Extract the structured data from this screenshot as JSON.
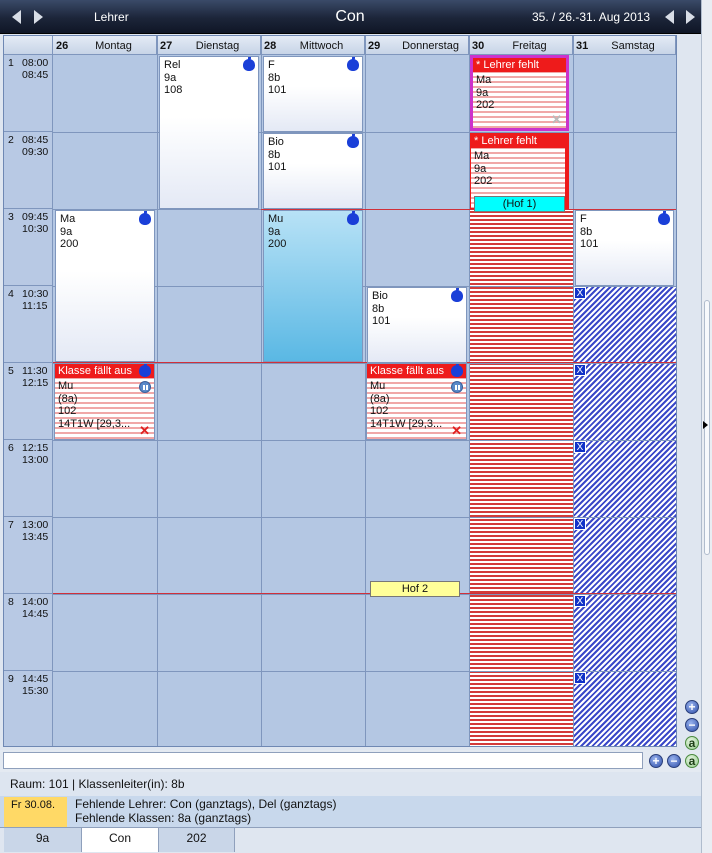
{
  "topbar": {
    "left_label": "Lehrer",
    "title": "Con",
    "week_range": "35. / 26.-31. Aug 2013"
  },
  "days": [
    {
      "num": "26",
      "name": "Montag"
    },
    {
      "num": "27",
      "name": "Dienstag"
    },
    {
      "num": "28",
      "name": "Mittwoch"
    },
    {
      "num": "29",
      "name": "Donnerstag"
    },
    {
      "num": "30",
      "name": "Freitag"
    },
    {
      "num": "31",
      "name": "Samstag"
    }
  ],
  "periods": [
    {
      "n": "1",
      "start": "08:00",
      "end": "08:45"
    },
    {
      "n": "2",
      "start": "08:45",
      "end": "09:30"
    },
    {
      "n": "3",
      "start": "09:45",
      "end": "10:30"
    },
    {
      "n": "4",
      "start": "10:30",
      "end": "11:15"
    },
    {
      "n": "5",
      "start": "11:30",
      "end": "12:15"
    },
    {
      "n": "6",
      "start": "12:15",
      "end": "13:00"
    },
    {
      "n": "7",
      "start": "13:00",
      "end": "13:45"
    },
    {
      "n": "8",
      "start": "14:00",
      "end": "14:45"
    },
    {
      "n": "9",
      "start": "14:45",
      "end": "15:30"
    }
  ],
  "lessons": {
    "tue_p1": {
      "subject": "Rel",
      "class": "9a",
      "room": "108"
    },
    "wed_p1": {
      "subject": "F",
      "class": "8b",
      "room": "101"
    },
    "wed_p2": {
      "subject": "Bio",
      "class": "8b",
      "room": "101"
    },
    "mon_p3": {
      "subject": "Ma",
      "class": "9a",
      "room": "200"
    },
    "wed_p3": {
      "subject": "Mu",
      "class": "9a",
      "room": "200"
    },
    "sat_p3": {
      "subject": "F",
      "class": "8b",
      "room": "101"
    },
    "thu_p4": {
      "subject": "Bio",
      "class": "8b",
      "room": "101"
    },
    "fri_p1": {
      "banner": "* Lehrer fehlt",
      "subject": "Ma",
      "class": "9a",
      "room": "202"
    },
    "fri_p2": {
      "banner": "* Lehrer fehlt",
      "subject": "Ma",
      "class": "9a",
      "room": "202"
    },
    "mon_p5": {
      "banner": "Klasse fällt aus",
      "subject": "Mu",
      "class": "(8a)",
      "room": "102",
      "extra": "14T1W [29,3..."
    },
    "thu_p5": {
      "banner": "Klasse fällt aus",
      "subject": "Mu",
      "class": "(8a)",
      "room": "102",
      "extra": "14T1W [29,3..."
    }
  },
  "breaks": {
    "hof1": "(Hof 1)",
    "hof2": "Hof 2"
  },
  "absent_marker": "X",
  "zoom": {
    "plus": "+",
    "minus": "−",
    "a": "a"
  },
  "info_line": "Raum: 101 | Klassenleiter(in): 8b",
  "missing": {
    "date": "Fr 30.08.",
    "teachers": "Fehlende Lehrer: Con (ganztags), Del (ganztags)",
    "classes": "Fehlende Klassen: 8a (ganztags)"
  },
  "tabs": [
    {
      "label": "9a",
      "active": false
    },
    {
      "label": "Con",
      "active": true
    },
    {
      "label": "202",
      "active": false
    }
  ],
  "command_input": {
    "value": "",
    "placeholder": ""
  },
  "colors": {
    "grid_bg": "#b4c7e3",
    "absent_red": "#ee1b1b",
    "absent_blue": "#1032c8",
    "highlight_magenta": "#cc33cc",
    "music_blue": "#6fc3ea",
    "break_yellow": "#ffff99",
    "break_cyan": "#00ffff"
  }
}
